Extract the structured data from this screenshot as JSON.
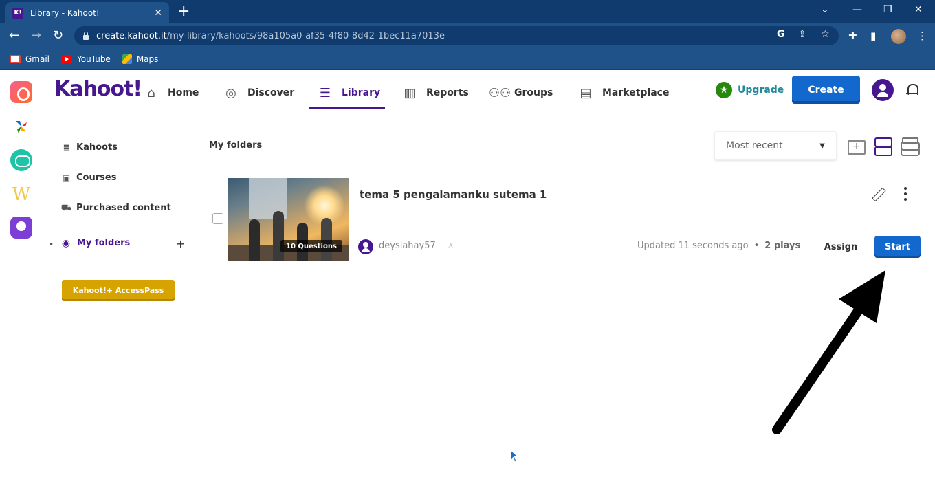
{
  "browser": {
    "tab_title": "Library - Kahoot!",
    "tab_favicon": "K!",
    "url_host": "create.kahoot.it",
    "url_path": "/my-library/kahoots/98a105a0-af35-4f80-8d42-1bec11a7013e",
    "bookmarks": [
      {
        "label": "Gmail"
      },
      {
        "label": "YouTube"
      },
      {
        "label": "Maps"
      }
    ]
  },
  "app": {
    "logo": "Kahoot!",
    "brand_color": "#46178f",
    "nav": [
      {
        "label": "Home",
        "icon": "home-icon"
      },
      {
        "label": "Discover",
        "icon": "compass-icon"
      },
      {
        "label": "Library",
        "icon": "list-icon",
        "active": true
      },
      {
        "label": "Reports",
        "icon": "bar-chart-icon"
      },
      {
        "label": "Groups",
        "icon": "groups-icon"
      },
      {
        "label": "Marketplace",
        "icon": "store-icon"
      }
    ],
    "upgrade_label": "Upgrade",
    "create_label": "Create"
  },
  "sidebar": {
    "items": [
      {
        "label": "Kahoots",
        "icon": "stack-icon"
      },
      {
        "label": "Courses",
        "icon": "courses-icon"
      },
      {
        "label": "Purchased content",
        "icon": "cart-icon"
      },
      {
        "label": "My folders",
        "icon": "user-circle-icon",
        "active": true
      }
    ],
    "access_pass_label": "Kahoot!+ AccessPass"
  },
  "main": {
    "section_title": "My folders",
    "sort": {
      "selected": "Most recent"
    },
    "kahoot": {
      "title": "tema 5 pengalamanku sutema 1",
      "questions_badge": "10 Questions",
      "owner": "deyslahay57",
      "updated": "Updated 11 seconds ago",
      "plays": "2 plays",
      "assign_label": "Assign",
      "start_label": "Start"
    }
  }
}
